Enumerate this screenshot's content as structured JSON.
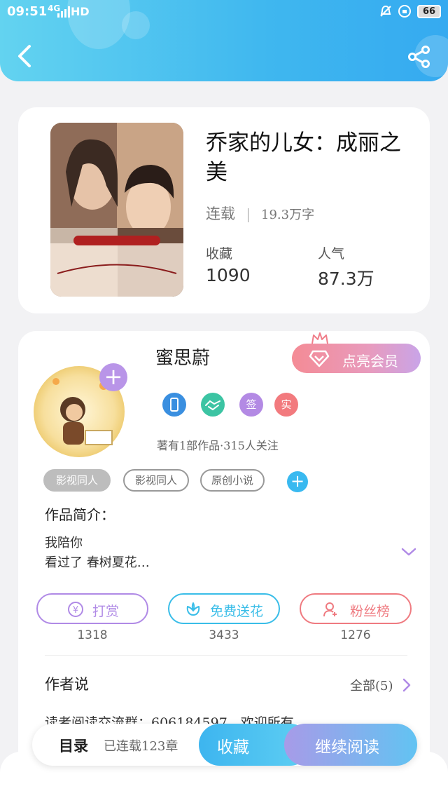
{
  "status_bar": {
    "time": "09:51",
    "signal": "4G",
    "network": "HD",
    "battery": "66"
  },
  "book": {
    "title": "乔家的儿女：成丽之美",
    "status": "连载",
    "words": "19.3万字",
    "stats": [
      {
        "label": "收藏",
        "value": "1090"
      },
      {
        "label": "人气",
        "value": "87.3万"
      }
    ]
  },
  "author": {
    "name": "蜜思蔚",
    "vip_label": "点亮会员",
    "badges": [
      {
        "icon": "phone-badge-icon",
        "text": "",
        "color": "#3a8fe0"
      },
      {
        "icon": "handshake-badge-icon",
        "text": "",
        "color": "#3cc4a3"
      },
      {
        "icon": "sign-badge-icon",
        "text": "签",
        "color": "#b38ae4"
      },
      {
        "icon": "real-badge-icon",
        "text": "实",
        "color": "#f27a7e"
      }
    ],
    "works_info": "著有1部作品·315人关注"
  },
  "tags": [
    "影视同人",
    "影视同人",
    "原创小说"
  ],
  "intro": {
    "title": "作品简介：",
    "lines": [
      "我陪你",
      "看过了 春树夏花…"
    ]
  },
  "actions": [
    {
      "label": "打赏",
      "count": "1318",
      "icon": "yuan-icon",
      "color": "#b08ae6"
    },
    {
      "label": "免费送花",
      "count": "3433",
      "icon": "flower-icon",
      "color": "#39bde8"
    },
    {
      "label": "粉丝榜",
      "count": "1276",
      "icon": "fans-icon",
      "color": "#ef7a80"
    }
  ],
  "author_says": {
    "title": "作者说",
    "all_label": "全部(5)",
    "text": "读者阅读交流群：606184597，欢迎所有…"
  },
  "bottom_bar": {
    "toc": "目录",
    "chapters": "已连载123章",
    "collect": "收藏",
    "continue": "继续阅读"
  }
}
